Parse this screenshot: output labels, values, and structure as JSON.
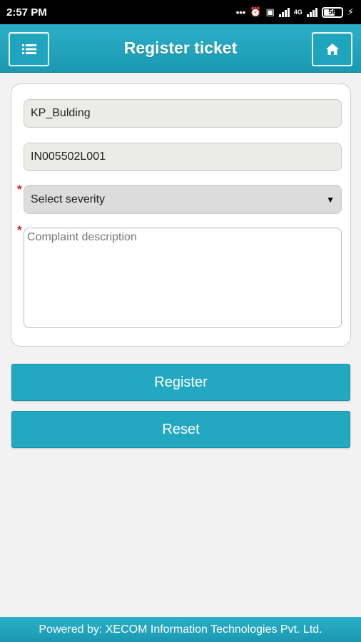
{
  "status_bar": {
    "time": "2:57 PM",
    "network_label": "4G",
    "battery_level": "56"
  },
  "header": {
    "title": "Register ticket",
    "menu_icon": "list-icon",
    "home_icon": "home-icon"
  },
  "form": {
    "building_value": "KP_Bulding",
    "asset_id_value": "IN005502L001",
    "severity_selected": "Select severity",
    "severity_required_mark": "*",
    "description_placeholder": "Complaint description",
    "description_required_mark": "*"
  },
  "actions": {
    "register_label": "Register",
    "reset_label": "Reset"
  },
  "footer": {
    "text": "Powered by: XECOM Information Technologies Pvt. Ltd."
  },
  "colors": {
    "accent": "#23a8c2",
    "required": "#d02020"
  }
}
